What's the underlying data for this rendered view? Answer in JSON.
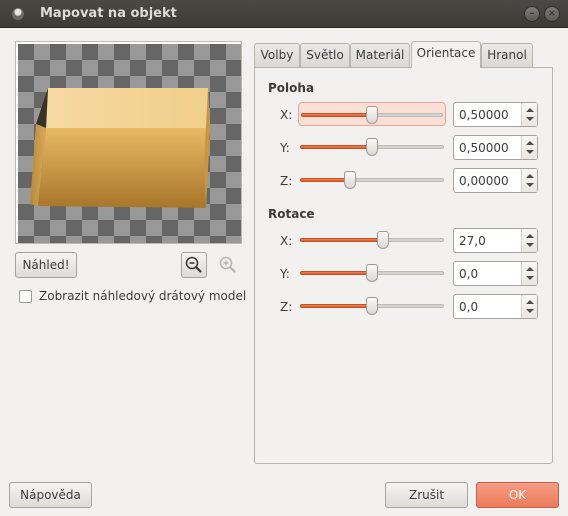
{
  "window": {
    "title": "Mapovat na objekt"
  },
  "preview": {
    "preview_button": "Náhled!",
    "wireframe_checkbox_label": "Zobrazit náhledový drátový model",
    "wireframe_checked": false
  },
  "tabs": [
    {
      "label": "Volby",
      "active": false
    },
    {
      "label": "Světlo",
      "active": false
    },
    {
      "label": "Materiál",
      "active": false
    },
    {
      "label": "Orientace",
      "active": true
    },
    {
      "label": "Hranol",
      "active": false
    }
  ],
  "position": {
    "label": "Poloha",
    "x": {
      "label": "X:",
      "value": "0,50000",
      "fraction": 0.5
    },
    "y": {
      "label": "Y:",
      "value": "0,50000",
      "fraction": 0.5
    },
    "z": {
      "label": "Z:",
      "value": "0,00000",
      "fraction": 0.35
    }
  },
  "rotation": {
    "label": "Rotace",
    "x": {
      "label": "X:",
      "value": "27,0",
      "fraction": 0.575
    },
    "y": {
      "label": "Y:",
      "value": "0,0",
      "fraction": 0.5
    },
    "z": {
      "label": "Z:",
      "value": "0,0",
      "fraction": 0.5
    }
  },
  "footer": {
    "help_button": "Nápověda",
    "cancel_button": "Zrušit",
    "ok_button": "OK"
  },
  "colors": {
    "accent": "#e9653b",
    "ok_button": "#f08c6e",
    "titlebar": "#3c3b37"
  }
}
